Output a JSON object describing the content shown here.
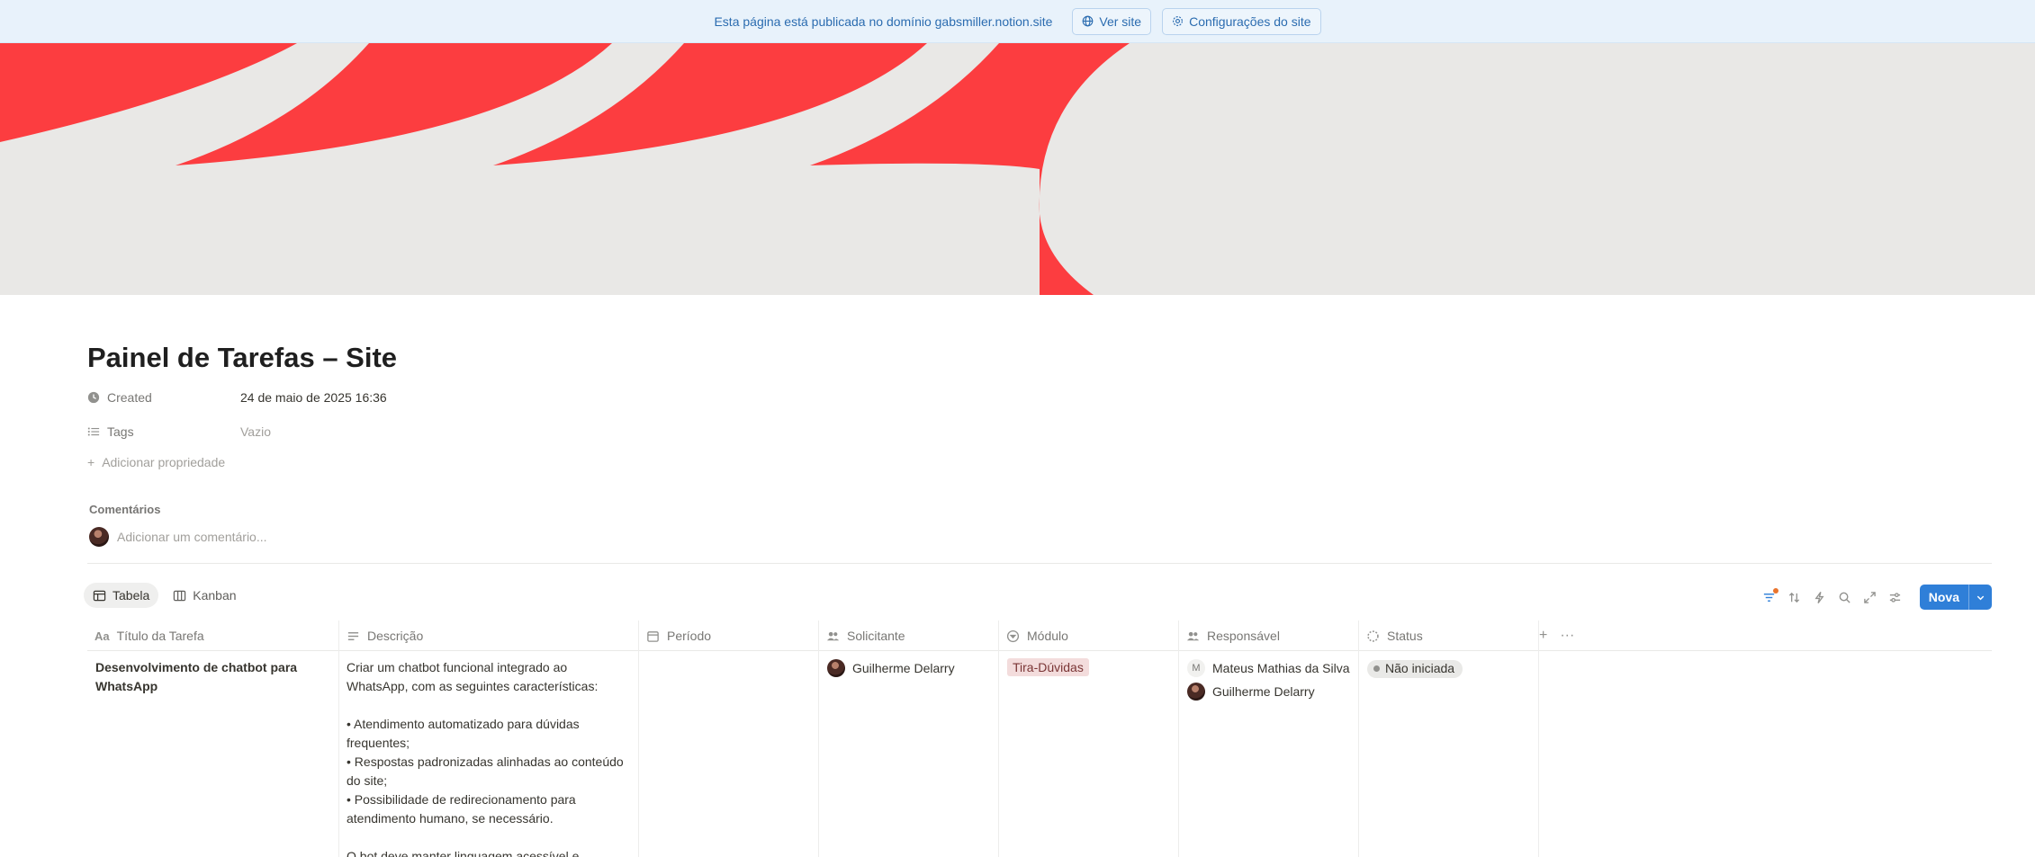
{
  "banner": {
    "message": "Esta página está publicada no domínio gabsmiller.notion.site",
    "view_site": "Ver site",
    "site_settings": "Configurações do site"
  },
  "page": {
    "title": "Painel de Tarefas – Site",
    "properties": [
      {
        "name": "Created",
        "value": "24 de maio de 2025 16:36",
        "icon": "clock-icon"
      },
      {
        "name": "Tags",
        "value": "Vazio",
        "icon": "list-icon"
      }
    ],
    "add_property": "Adicionar propriedade",
    "comments_label": "Comentários",
    "comment_placeholder": "Adicionar um comentário..."
  },
  "views": [
    {
      "label": "Tabela",
      "icon": "table-icon",
      "active": true
    },
    {
      "label": "Kanban",
      "icon": "board-icon",
      "active": false
    }
  ],
  "toolbar": {
    "new_label": "Nova",
    "icons": [
      "filter-icon",
      "sort-icon",
      "automation-icon",
      "search-icon",
      "expand-icon",
      "settings-icon"
    ]
  },
  "table": {
    "columns": [
      {
        "label": "Título da Tarefa",
        "icon": "text-icon"
      },
      {
        "label": "Descrição",
        "icon": "lines-icon"
      },
      {
        "label": "Período",
        "icon": "calendar-icon"
      },
      {
        "label": "Solicitante",
        "icon": "people-icon"
      },
      {
        "label": "Módulo",
        "icon": "select-icon"
      },
      {
        "label": "Responsável",
        "icon": "people-icon"
      },
      {
        "label": "Status",
        "icon": "status-icon"
      }
    ],
    "row": {
      "title": "Desenvolvimento de chatbot para WhatsApp",
      "description": [
        "Criar um chatbot funcional integrado ao WhatsApp, com as seguintes características:",
        "",
        "• Atendimento automatizado para dúvidas frequentes;",
        "• Respostas padronizadas alinhadas ao conteúdo do site;",
        "• Possibilidade de redirecionamento para atendimento humano, se necessário.",
        "",
        "O bot deve manter linguagem acessível e coerente"
      ],
      "period": "",
      "requester": "Guilherme Delarry",
      "module": "Tira-Dúvidas",
      "responsible": [
        {
          "initial": "M",
          "name": "Mateus Mathias da Silva"
        },
        {
          "initial": "",
          "name": "Guilherme Delarry"
        }
      ],
      "status": "Não iniciada"
    }
  },
  "colors": {
    "accent": "#2f7fd8",
    "banner_bg": "#e8f2fb",
    "cover_red": "#fc3d40",
    "tag_bg": "#f3dcdc"
  }
}
